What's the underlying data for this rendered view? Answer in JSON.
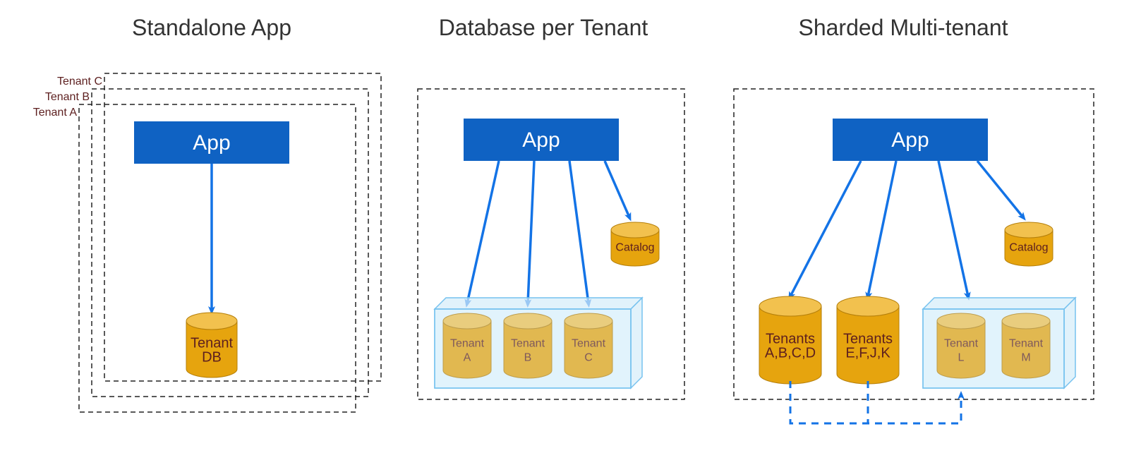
{
  "titles": {
    "standalone": "Standalone App",
    "dbpertenant": "Database per Tenant",
    "sharded": "Sharded Multi-tenant"
  },
  "app_label": "App",
  "catalog_label": "Catalog",
  "standalone": {
    "stack_labels": [
      "Tenant C",
      "Tenant B",
      "Tenant A"
    ],
    "db_label_line1": "Tenant",
    "db_label_line2": "DB"
  },
  "dbpertenant": {
    "dbs": [
      {
        "line1": "Tenant",
        "line2": "A"
      },
      {
        "line1": "Tenant",
        "line2": "B"
      },
      {
        "line1": "Tenant",
        "line2": "C"
      }
    ]
  },
  "sharded": {
    "big_dbs": [
      {
        "line1": "Tenants",
        "line2": "A,B,C,D"
      },
      {
        "line1": "Tenants",
        "line2": "E,F,J,K"
      }
    ],
    "pool_dbs": [
      {
        "line1": "Tenant",
        "line2": "L"
      },
      {
        "line1": "Tenant",
        "line2": "M"
      }
    ]
  },
  "colors": {
    "app": "#0f62c3",
    "arrow": "#1373e6",
    "cyl_top": "#f2c14e",
    "cyl_side": "#e6a40e",
    "pool_fill": "#d4ecfa",
    "pool_stroke": "#76c2ef",
    "dash": "#222222"
  }
}
